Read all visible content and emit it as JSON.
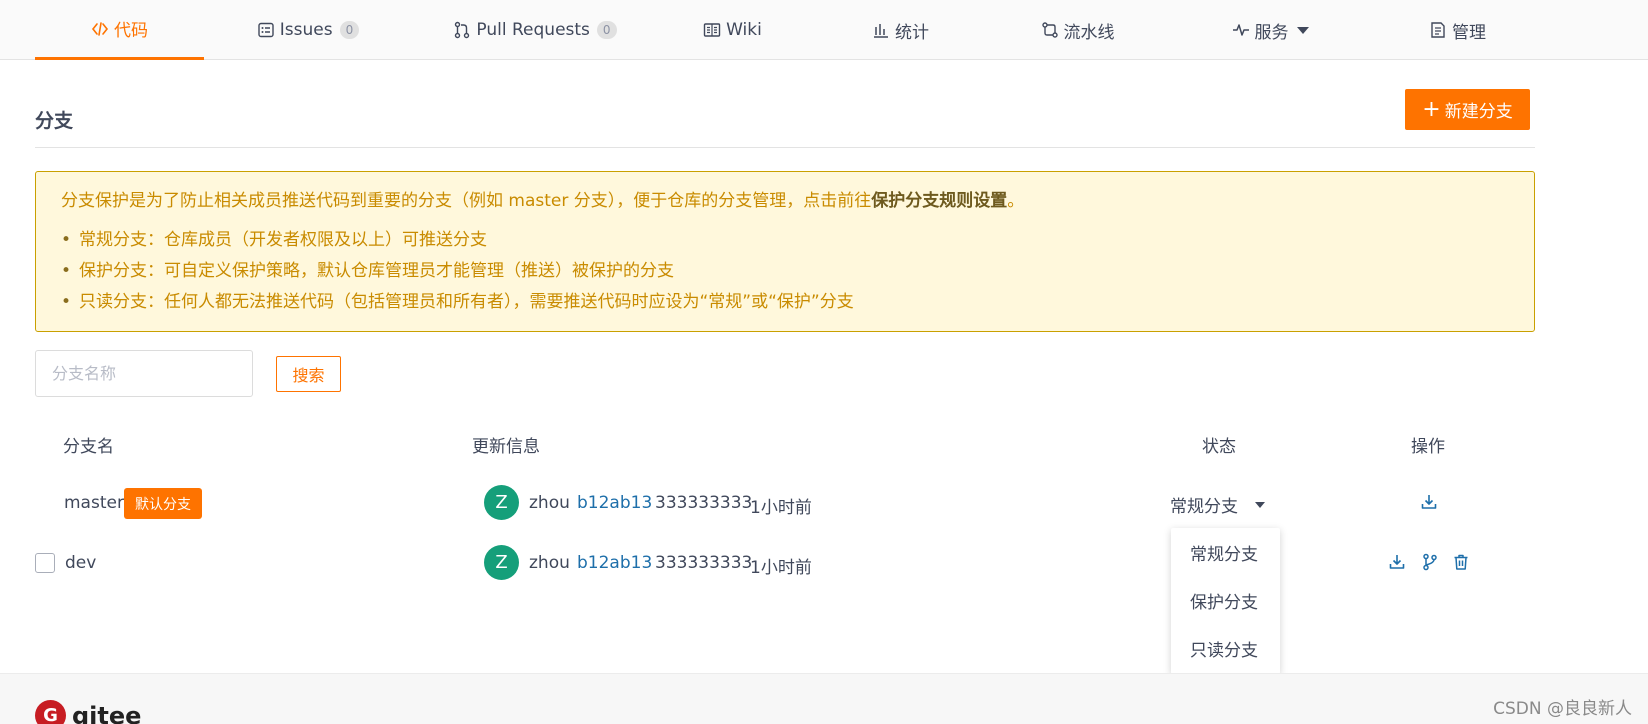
{
  "nav": {
    "tabs": [
      {
        "label": "代码",
        "icon": "code-icon",
        "active": true
      },
      {
        "label": "Issues",
        "icon": "issues-icon",
        "count": "0"
      },
      {
        "label": "Pull Requests",
        "icon": "pull-request-icon",
        "count": "0"
      },
      {
        "label": "Wiki",
        "icon": "book-icon"
      },
      {
        "label": "统计",
        "icon": "bar-chart-icon"
      },
      {
        "label": "流水线",
        "icon": "pipeline-icon"
      },
      {
        "label": "服务",
        "icon": "pulse-icon"
      },
      {
        "label": "管理",
        "icon": "document-icon"
      }
    ]
  },
  "header": {
    "title": "分支",
    "new_branch_plus": "+",
    "new_branch_label": "新建分支"
  },
  "notice": {
    "lead": "分支保护是为了防止相关成员推送代码到重要的分支（例如 master 分支），便于仓库的分支管理，点击前往",
    "lead_link": "保护分支规则设置",
    "lead_end": "。",
    "items": [
      "常规分支：仓库成员（开发者权限及以上）可推送分支",
      "保护分支：可自定义保护策略，默认仓库管理员才能管理（推送）被保护的分支",
      "只读分支：任何人都无法推送代码（包括管理员和所有者），需要推送代码时应设为“常规”或“保护”分支"
    ]
  },
  "search": {
    "placeholder": "分支名称",
    "button": "搜索"
  },
  "table": {
    "headers": {
      "name": "分支名",
      "update": "更新信息",
      "status": "状态",
      "actions": "操作"
    },
    "rows": [
      {
        "name": "master",
        "badge": "默认分支",
        "avatar": "Z",
        "author": "zhou",
        "commit": "b12ab13",
        "message": "333333333",
        "time": "1小时前",
        "status": "常规分支"
      },
      {
        "name": "dev",
        "avatar": "Z",
        "author": "zhou",
        "commit": "b12ab13",
        "message": "333333333",
        "time": "1小时前"
      }
    ]
  },
  "dropdown": {
    "options": [
      "常规分支",
      "保护分支",
      "只读分支"
    ]
  },
  "footer": {
    "logo_mark": "G",
    "logo_text": "gitee",
    "watermark": "CSDN @良良新人"
  },
  "colors": {
    "accent": "#fe7300",
    "link": "#1e6faa",
    "avatar": "#159f7a",
    "notice_bg": "#fff8dc",
    "notice_border": "#c9a000"
  }
}
